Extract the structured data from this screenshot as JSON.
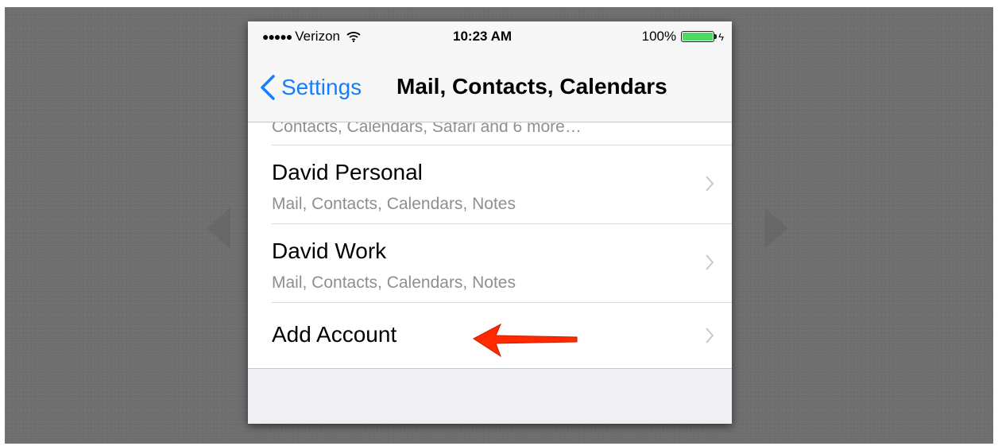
{
  "status_bar": {
    "signal": "●●●●●",
    "carrier": "Verizon",
    "time": "10:23 AM",
    "battery": "100%",
    "battery_level": 1.0,
    "icons": [
      "wifi-icon",
      "battery-icon",
      "charging-bolt-icon"
    ]
  },
  "nav": {
    "back_label": "Settings",
    "title": "Mail, Contacts, Calendars",
    "accent_color": "#147efb"
  },
  "accounts": {
    "partial_row_text": "Contacts, Calendars, Safari and 6 more…",
    "items": [
      {
        "name": "David Personal",
        "detail": "Mail, Contacts, Calendars, Notes"
      },
      {
        "name": "David Work",
        "detail": "Mail, Contacts, Calendars, Notes"
      }
    ],
    "add_account_label": "Add Account"
  },
  "annotation": {
    "arrow_color": "#ff2a00",
    "icon": "red-pointer-arrow"
  }
}
